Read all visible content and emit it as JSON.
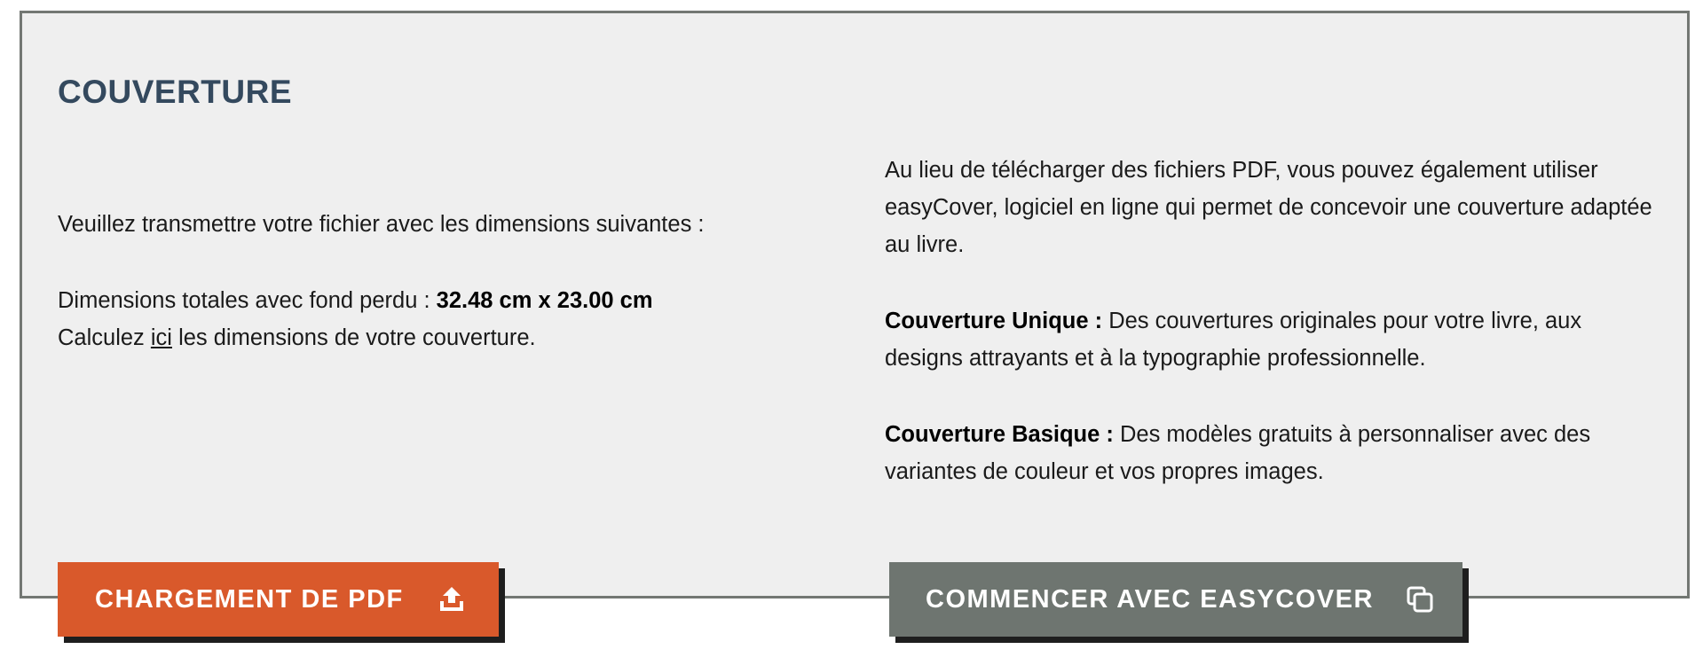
{
  "section": {
    "title": "COUVERTURE"
  },
  "left": {
    "intro": "Veuillez transmettre votre fichier avec les dimensions suivantes :",
    "dimensions_label": "Dimensions totales avec fond perdu : ",
    "dimensions_value": "32.48 cm x 23.00 cm",
    "calc_prefix": "Calculez ",
    "calc_link": "ici",
    "calc_suffix": " les dimensions de votre couverture."
  },
  "right": {
    "intro": "Au lieu de télécharger des fichiers PDF, vous pouvez également utiliser easyCover, logiciel en ligne qui permet de concevoir une couverture adaptée au livre.",
    "unique_label": "Couverture Unique :",
    "unique_text": " Des couvertures originales pour votre livre, aux designs attrayants et à la typographie professionnelle.",
    "basic_label": "Couverture Basique :",
    "basic_text": " Des modèles gratuits à personnaliser avec des variantes de couleur et vos propres images."
  },
  "buttons": {
    "pdf_label": "CHARGEMENT DE PDF",
    "pdf_icon": "upload-icon",
    "easycover_label": "COMMENCER AVEC EASYCOVER",
    "easycover_icon": "copy-icon"
  },
  "colors": {
    "title": "#34495e",
    "pdf_button": "#d9592b",
    "easycover_button": "#6e7570",
    "panel_bg": "#efefef",
    "panel_border": "#737773"
  }
}
